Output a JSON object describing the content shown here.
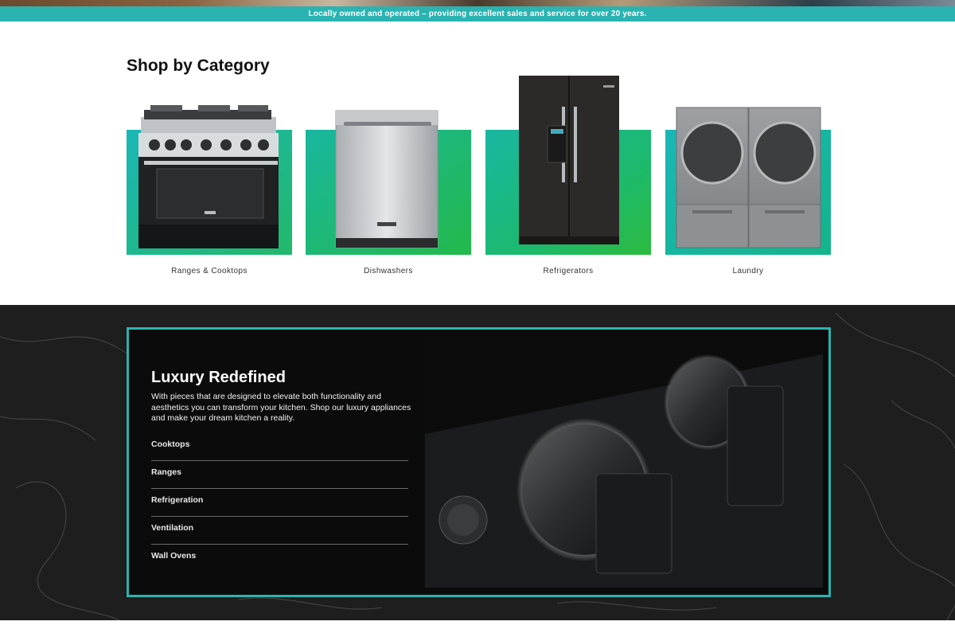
{
  "announcement": "Locally owned and operated – providing excellent sales and service for over 20 years.",
  "categories": {
    "title": "Shop by Category",
    "items": [
      {
        "label": "Ranges & Cooktops",
        "icon": "range-oven-image"
      },
      {
        "label": "Dishwashers",
        "icon": "dishwasher-image"
      },
      {
        "label": "Refrigerators",
        "icon": "refrigerator-image"
      },
      {
        "label": "Laundry",
        "icon": "washer-dryer-image"
      }
    ]
  },
  "luxury": {
    "title": "Luxury Redefined",
    "description": "With pieces that are designed to elevate both functionality and aesthetics you can transform your kitchen. Shop our luxury appliances and make your dream kitchen a reality.",
    "links": [
      "Cooktops",
      "Ranges",
      "Refrigeration",
      "Ventilation",
      "Wall Ovens"
    ]
  },
  "colors": {
    "accent_teal": "#2bb3b1",
    "card_gradient_teal": "#1ab7b6",
    "card_gradient_green": "#23b94a",
    "dark_background": "#1c1c1c"
  }
}
